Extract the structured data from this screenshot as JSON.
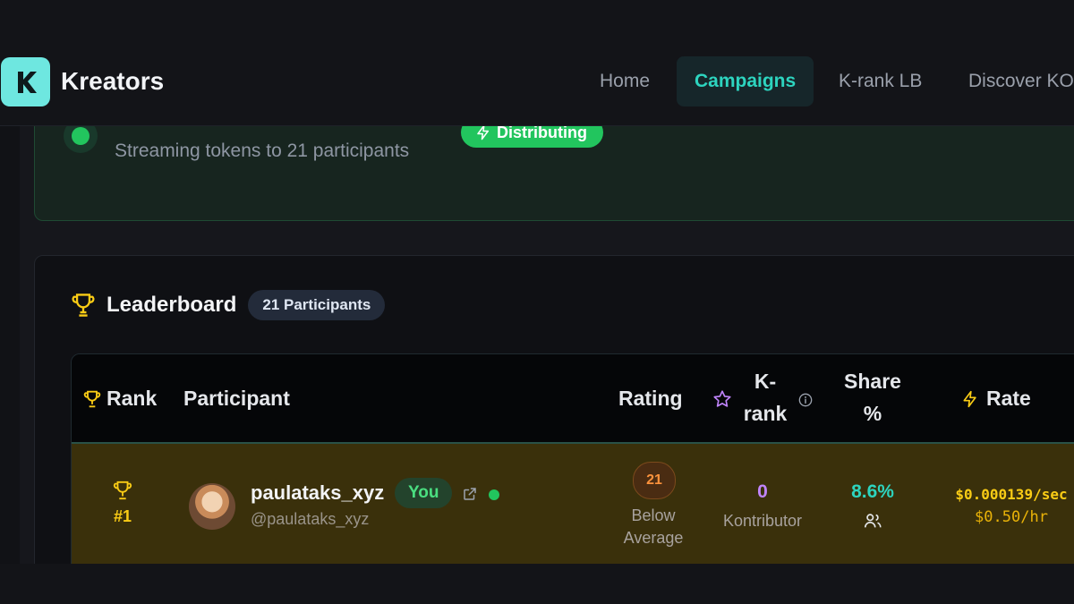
{
  "brand": {
    "name": "Kreators",
    "logo_letter": "K"
  },
  "nav": {
    "items": [
      {
        "label": "Home",
        "active": false
      },
      {
        "label": "Campaigns",
        "active": true
      },
      {
        "label": "K-rank LB",
        "active": false
      },
      {
        "label": "Discover KO",
        "active": false
      }
    ]
  },
  "status": {
    "text": "Streaming tokens to 21 participants",
    "badge": "Distributing"
  },
  "leaderboard": {
    "title": "Leaderboard",
    "participants_badge": "21 Participants",
    "columns": {
      "rank": "Rank",
      "participant": "Participant",
      "rating": "Rating",
      "krank_1": "K-",
      "krank_2": "rank",
      "share_1": "Share",
      "share_2": "%",
      "rate": "Rate"
    },
    "rows": [
      {
        "rank": "#1",
        "name": "paulataks_xyz",
        "handle": "@paulataks_xyz",
        "you_badge": "You",
        "rating_value": "21",
        "rating_label_1": "Below",
        "rating_label_2": "Average",
        "krank_value": "0",
        "krank_label": "Kontributor",
        "share": "8.6%",
        "rate_per_sec": "$0.000139/sec",
        "rate_per_hr": "$0.50/hr"
      }
    ]
  },
  "colors": {
    "accent_teal": "#2dd4bf",
    "success_green": "#22c55e",
    "gold": "#facc15",
    "purple": "#c084fc",
    "orange": "#fb923c"
  }
}
